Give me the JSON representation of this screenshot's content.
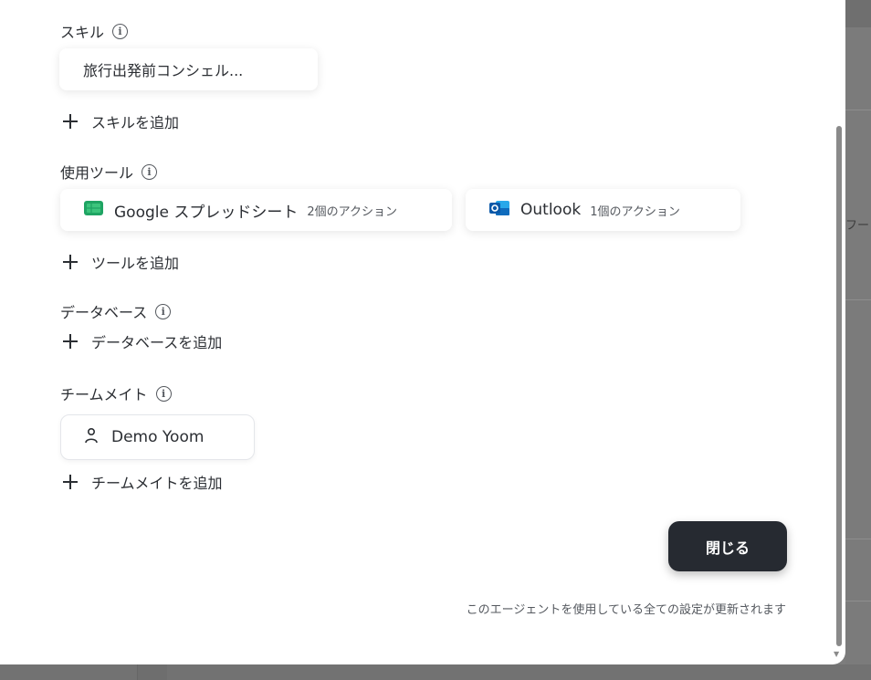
{
  "sections": {
    "skills": {
      "label": "スキル",
      "items": [
        "旅行出発前コンシェル..."
      ],
      "add_label": "スキルを追加"
    },
    "tools": {
      "label": "使用ツール",
      "items": [
        {
          "name": "Google スプレッドシート",
          "actions": "2個のアクション",
          "icon": "google-sheets-icon",
          "color": "#1fa463"
        },
        {
          "name": "Outlook",
          "actions": "1個のアクション",
          "icon": "outlook-icon",
          "color": "#0f6cbd"
        }
      ],
      "add_label": "ツールを追加"
    },
    "database": {
      "label": "データベース",
      "add_label": "データベースを追加"
    },
    "teammates": {
      "label": "チームメイト",
      "items": [
        "Demo Yoom"
      ],
      "add_label": "チームメイトを追加"
    }
  },
  "close_button": "閉じる",
  "footnote": "このエージェントを使用している全ての設定が更新されます",
  "background": {
    "partial_text": "フー"
  }
}
